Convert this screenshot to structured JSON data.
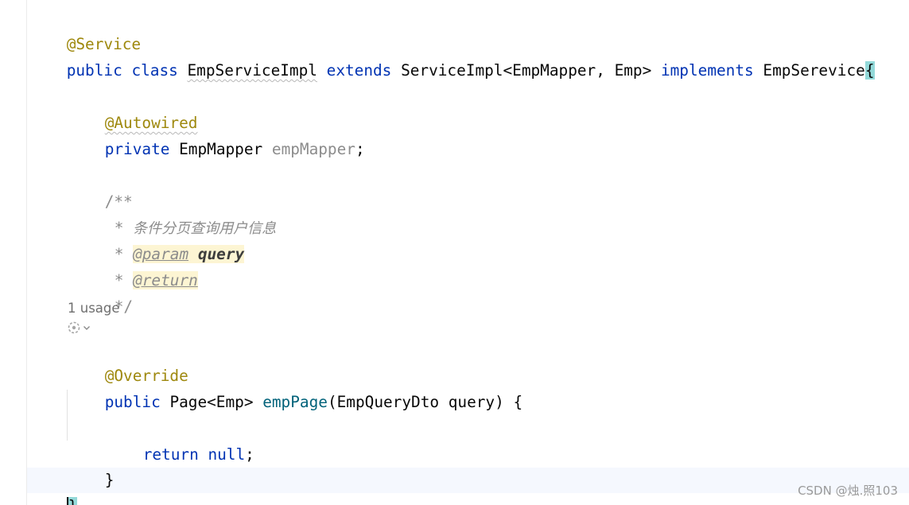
{
  "editor": {
    "annotation_service": "@Service",
    "class_decl": {
      "kw_public": "public",
      "kw_class": "class",
      "class_name": "EmpServiceImpl",
      "kw_extends": "extends",
      "super_type": "ServiceImpl<EmpMapper, Emp>",
      "kw_implements": "implements",
      "interface_name": "EmpSerevice",
      "open_brace": "{"
    },
    "field": {
      "annotation": "@Autowired",
      "kw_private": "private",
      "type": "EmpMapper",
      "name": "empMapper",
      "semicolon": ";"
    },
    "javadoc": {
      "open": "/**",
      "star": "*",
      "description": "条件分页查询用户信息",
      "param_tag": "@param",
      "param_name": "query",
      "return_tag": "@return",
      "close": "*/"
    },
    "usage_hint": "1 usage",
    "method": {
      "annotation": "@Override",
      "kw_public": "public",
      "return_type": "Page<Emp>",
      "name": "empPage",
      "open_paren": "(",
      "param_type": "EmpQueryDto",
      "param_name": "query",
      "close_sig": ") {",
      "kw_return": "return",
      "kw_null": "null",
      "semicolon": ";",
      "close_brace": "}"
    },
    "class_close_brace": "}",
    "author_icon": "git-author-icon",
    "dropdown_icon": "chevron-down-icon"
  },
  "watermark": "CSDN @烛.照103",
  "colors": {
    "keyword": "#0033b3",
    "annotation": "#9e880d",
    "method_name": "#00627a",
    "comment": "#8c8c8c",
    "brace_match": "#93d9d9",
    "current_line": "#f5f8fe"
  }
}
